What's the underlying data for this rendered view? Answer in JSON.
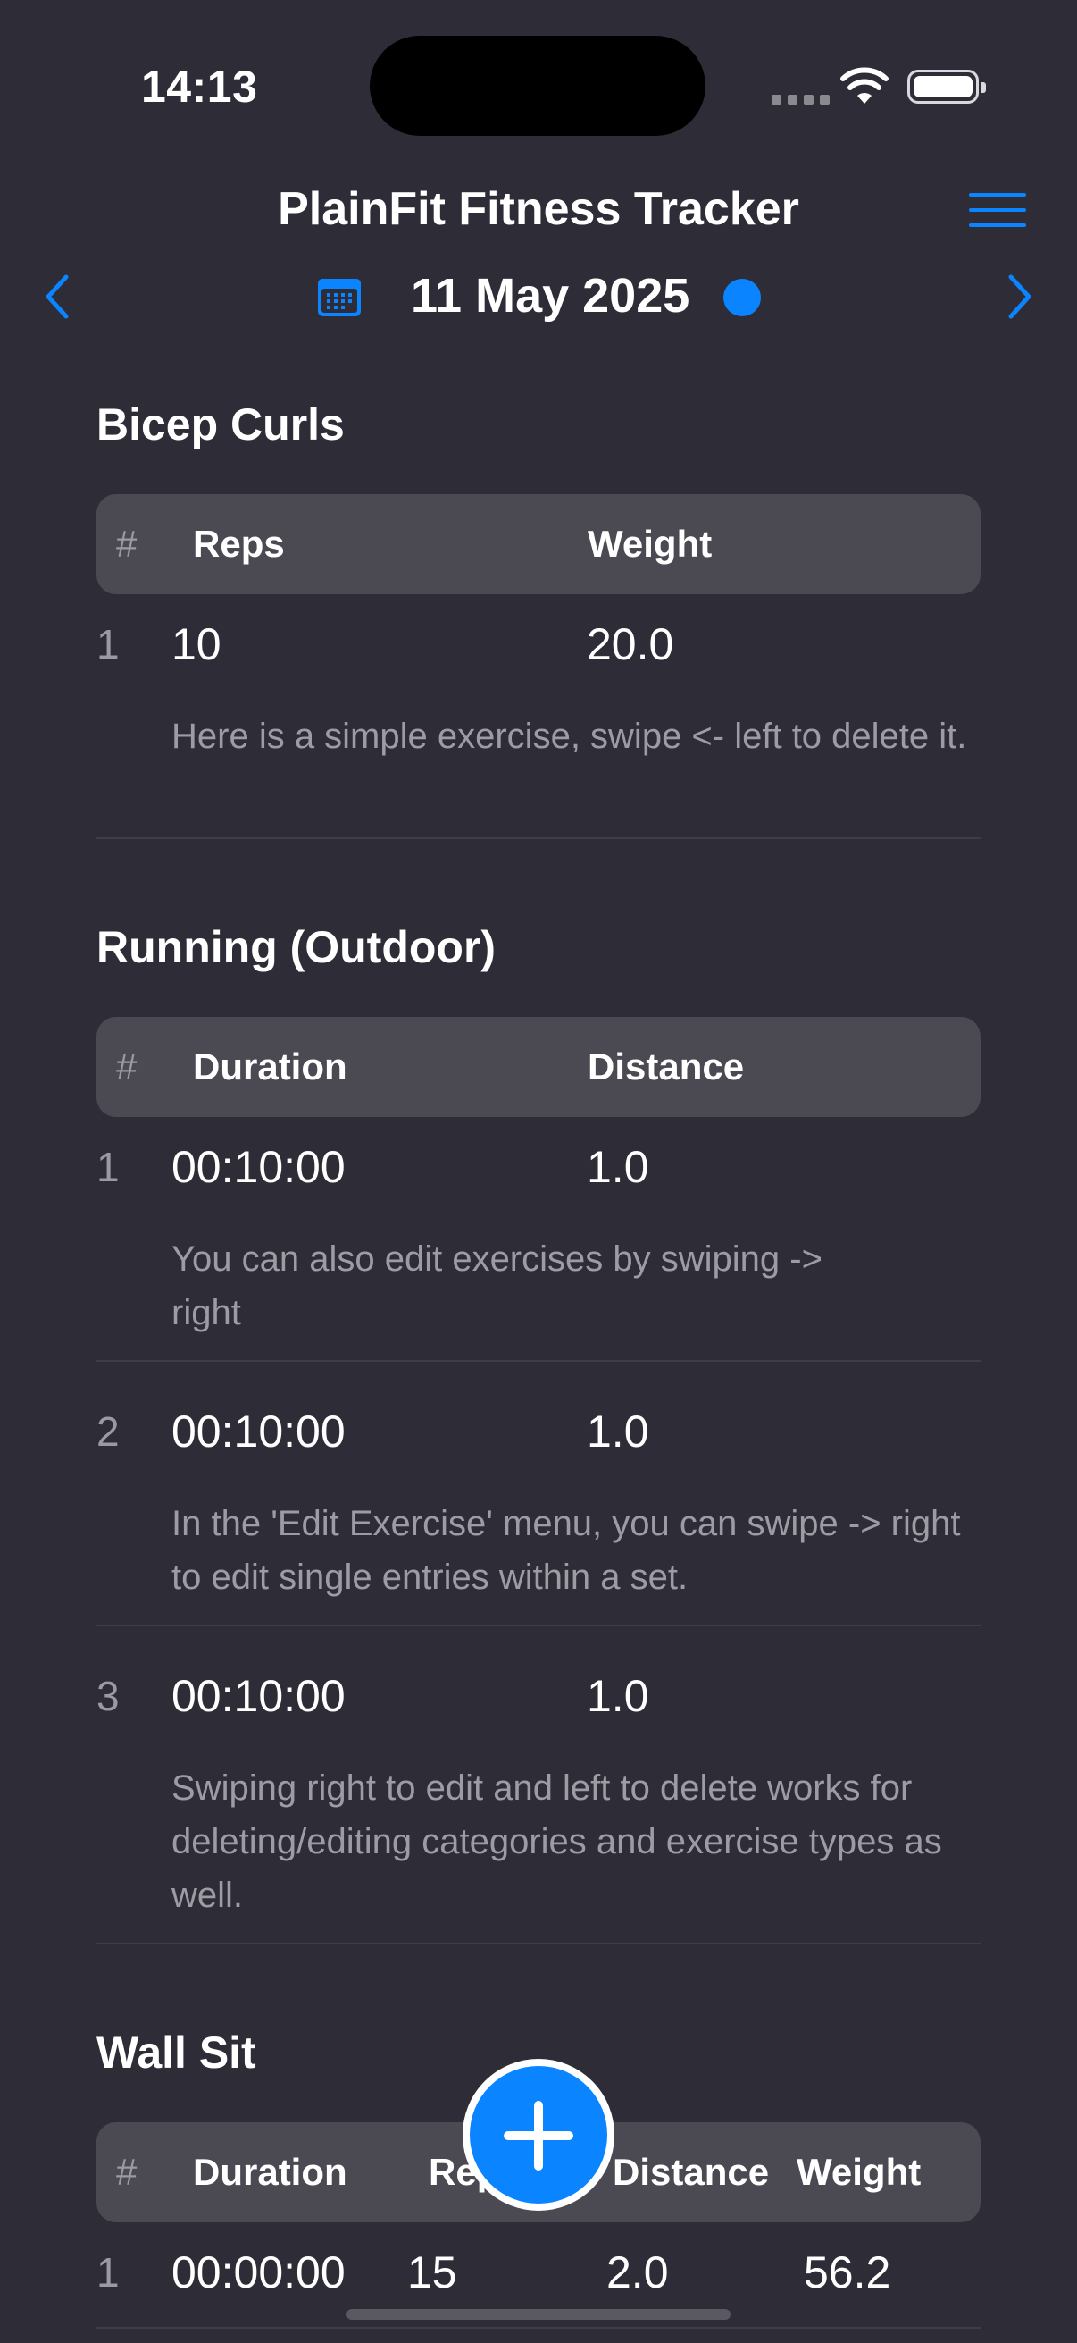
{
  "status": {
    "time": "14:13"
  },
  "header": {
    "title": "PlainFit Fitness Tracker",
    "date": "11 May 2025",
    "accent_color": "#0a84ff",
    "icons": [
      "menu-icon",
      "chevron-left-icon",
      "calendar-icon",
      "chevron-right-icon"
    ]
  },
  "exercises": [
    {
      "name": "Bicep Curls",
      "columns": [
        "#",
        "Reps",
        "Weight"
      ],
      "rows": [
        {
          "num": "1",
          "values": [
            "10",
            "20.0"
          ],
          "note": "Here is a simple exercise, swipe <- left to delete it."
        }
      ]
    },
    {
      "name": "Running (Outdoor)",
      "columns": [
        "#",
        "Duration",
        "Distance"
      ],
      "rows": [
        {
          "num": "1",
          "values": [
            "00:10:00",
            "1.0"
          ],
          "note": "You can also edit exercises by swiping -> right"
        },
        {
          "num": "2",
          "values": [
            "00:10:00",
            "1.0"
          ],
          "note": "In the 'Edit Exercise' menu, you can swipe -> right to edit single entries within a set."
        },
        {
          "num": "3",
          "values": [
            "00:10:00",
            "1.0"
          ],
          "note": "Swiping right to edit and left to delete works for deleting/editing categories and exercise types as well."
        }
      ]
    },
    {
      "name": "Wall Sit",
      "columns": [
        "#",
        "Duration",
        "Reps",
        "Distance",
        "Weight"
      ],
      "rows": [
        {
          "num": "1",
          "values": [
            "00:00:00",
            "15",
            "2.0",
            "56.2"
          ]
        }
      ]
    }
  ],
  "fab": {
    "icon": "plus-icon"
  }
}
